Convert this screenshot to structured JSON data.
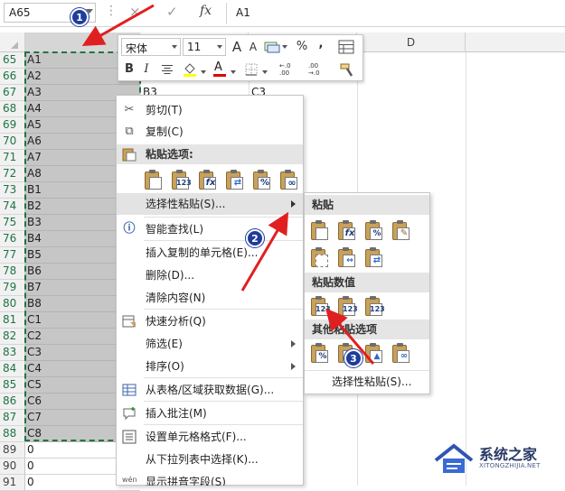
{
  "formula_bar": {
    "name_box": "A65",
    "cancel_icon": "×",
    "enter_icon": "✓",
    "fx_label": "fx",
    "value": "A1"
  },
  "columns": [
    {
      "id": "A",
      "label": ""
    },
    {
      "id": "B",
      "label": ""
    },
    {
      "id": "C",
      "label": ""
    },
    {
      "id": "D",
      "label": "D"
    }
  ],
  "rows": [
    {
      "num": "65",
      "a": "A1",
      "selected": true
    },
    {
      "num": "66",
      "a": "A2",
      "selected": true
    },
    {
      "num": "67",
      "a": "A3",
      "selected": true,
      "b": "B3",
      "c": "C3"
    },
    {
      "num": "68",
      "a": "A4",
      "selected": true
    },
    {
      "num": "69",
      "a": "A5",
      "selected": true
    },
    {
      "num": "70",
      "a": "A6",
      "selected": true
    },
    {
      "num": "71",
      "a": "A7",
      "selected": true
    },
    {
      "num": "72",
      "a": "A8",
      "selected": true
    },
    {
      "num": "73",
      "a": "B1",
      "selected": true
    },
    {
      "num": "74",
      "a": "B2",
      "selected": true
    },
    {
      "num": "75",
      "a": "B3",
      "selected": true
    },
    {
      "num": "76",
      "a": "B4",
      "selected": true
    },
    {
      "num": "77",
      "a": "B5",
      "selected": true
    },
    {
      "num": "78",
      "a": "B6",
      "selected": true
    },
    {
      "num": "79",
      "a": "B7",
      "selected": true
    },
    {
      "num": "80",
      "a": "B8",
      "selected": true
    },
    {
      "num": "81",
      "a": "C1",
      "selected": true
    },
    {
      "num": "82",
      "a": "C2",
      "selected": true
    },
    {
      "num": "83",
      "a": "C3",
      "selected": true
    },
    {
      "num": "84",
      "a": "C4",
      "selected": true
    },
    {
      "num": "85",
      "a": "C5",
      "selected": true
    },
    {
      "num": "86",
      "a": "C6",
      "selected": true
    },
    {
      "num": "87",
      "a": "C7",
      "selected": true
    },
    {
      "num": "88",
      "a": "C8",
      "selected": true
    },
    {
      "num": "89",
      "a": "0",
      "selected": false
    },
    {
      "num": "90",
      "a": "0",
      "selected": false
    },
    {
      "num": "91",
      "a": "0",
      "selected": false
    }
  ],
  "mini_toolbar": {
    "font_name": "宋体",
    "font_size": "11",
    "grow_font": "A",
    "shrink_font": "A",
    "percent": "%",
    "comma": ",",
    "bold": "B",
    "italic": "I",
    "font_color_glyph": "A",
    "increase_decimal": "←.0\n.00",
    "decrease_decimal": ".00\n→.0"
  },
  "context_menu": {
    "cut": "剪切(T)",
    "copy": "复制(C)",
    "paste_options_header": "粘贴选项:",
    "paste_special": "选择性粘贴(S)...",
    "smart_lookup": "智能查找(L)",
    "insert_copied": "插入复制的单元格(E)...",
    "delete": "删除(D)...",
    "clear": "清除内容(N)",
    "quick_analysis": "快速分析(Q)",
    "filter": "筛选(E)",
    "sort": "排序(O)",
    "get_data": "从表格/区域获取数据(G)...",
    "insert_comment": "插入批注(M)",
    "format_cells": "设置单元格格式(F)...",
    "pick_list": "从下拉列表中选择(K)...",
    "phonetic": "显示拼音字段(S)",
    "phonetic_icon_text": "wén"
  },
  "paste_icon_glyphs": {
    "values": "123",
    "formulas": "fx",
    "percent": "%",
    "link": "∞"
  },
  "submenu": {
    "paste_header": "粘贴",
    "paste_values_header": "粘贴数值",
    "other_header": "其他粘贴选项",
    "paste_special": "选择性粘贴(S)..."
  },
  "annotations": {
    "badge1": "1",
    "badge2": "2",
    "badge3": "3"
  },
  "watermark": {
    "text": "系统之家",
    "sub": "XITONGZHIJIA.NET"
  },
  "colors": {
    "selection": "#c6c6c6",
    "marching_ants": "#217346",
    "arrow": "#e02020",
    "badge": "#1f3c9c"
  }
}
